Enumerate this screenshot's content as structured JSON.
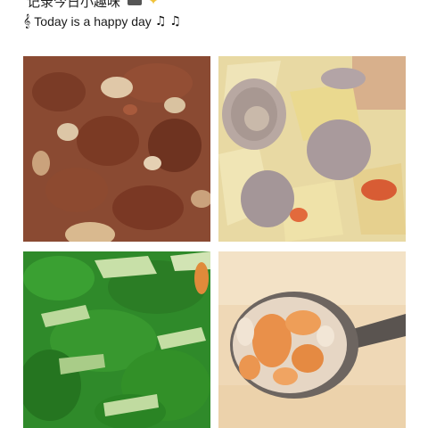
{
  "post": {
    "header_text": "记录今日小趣味",
    "caption": "Today is a happy day",
    "caption_prefix_icon": "treble-clef-icon",
    "caption_suffix_icons": [
      "beamed-notes-icon",
      "beamed-notes-icon"
    ],
    "photos": [
      {
        "name": "braised-pork-with-potatoes-photo"
      },
      {
        "name": "meatball-and-cabbage-soup-photo"
      },
      {
        "name": "stir-fried-bok-choy-photo"
      },
      {
        "name": "carrot-millet-porridge-photo"
      }
    ]
  }
}
